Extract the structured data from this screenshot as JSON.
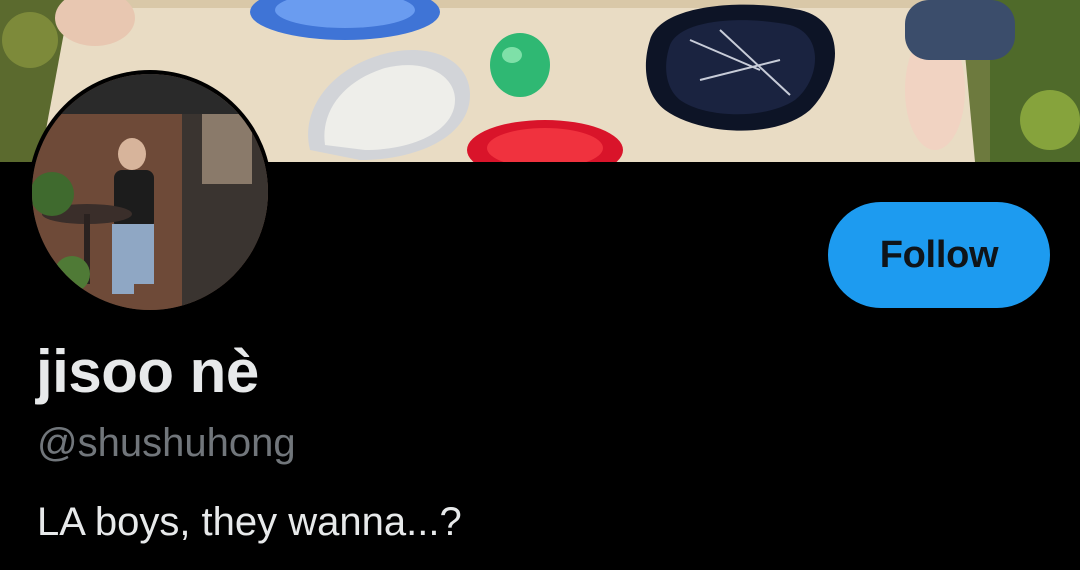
{
  "profile": {
    "display_name": "jisoo nè",
    "handle": "@shushuhong",
    "bio": "LA boys, they wanna...?"
  },
  "actions": {
    "follow_label": "Follow"
  },
  "colors": {
    "background": "#000000",
    "follow_button": "#1d9bf0",
    "handle_text": "#71767b",
    "primary_text": "#e7e9ea"
  },
  "images": {
    "banner": "photo of ceramic dishes on a wooden tray",
    "avatar": "photo of a person sitting outdoors at a cafe table"
  }
}
